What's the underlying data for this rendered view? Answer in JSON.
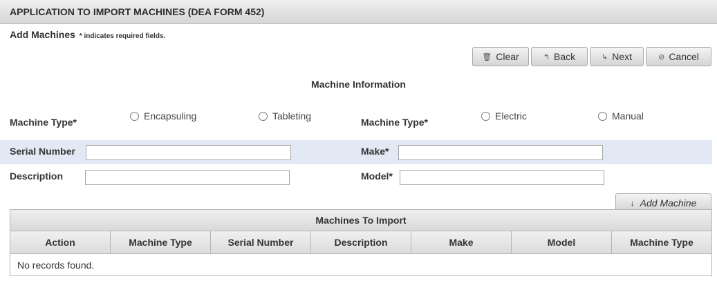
{
  "title": "APPLICATION TO IMPORT MACHINES (DEA FORM 452)",
  "subtitle": "Add Machines",
  "required_note": "* indicates required fields.",
  "toolbar": {
    "clear_label": "Clear",
    "back_label": "Back",
    "next_label": "Next",
    "cancel_label": "Cancel",
    "clear_icon": "trash-icon",
    "back_icon": "back-arrow-icon",
    "next_icon": "forward-arrow-icon",
    "cancel_icon": "cancel-icon"
  },
  "section_title": "Machine Information",
  "form": {
    "machine_type_label_1": "Machine Type*",
    "machine_type_options_1": [
      "Encapsuling",
      "Tableting"
    ],
    "machine_type_label_2": "Machine Type*",
    "machine_type_options_2": [
      "Electric",
      "Manual"
    ],
    "serial_number_label": "Serial Number",
    "serial_number_value": "",
    "make_label": "Make*",
    "make_value": "",
    "description_label": "Description",
    "description_value": "",
    "model_label": "Model*",
    "model_value": ""
  },
  "add_machine_label": "Add Machine",
  "add_machine_icon": "down-arrow-icon",
  "grid": {
    "caption": "Machines To  Import",
    "columns": [
      "Action",
      "Machine Type",
      "Serial Number",
      "Description",
      "Make",
      "Model",
      "Machine Type"
    ],
    "empty_text": "No records found."
  },
  "colors": {
    "highlight_row": "#e3e9f4",
    "header_gradient_top": "#efefef",
    "header_gradient_bottom": "#d6d6d6"
  }
}
